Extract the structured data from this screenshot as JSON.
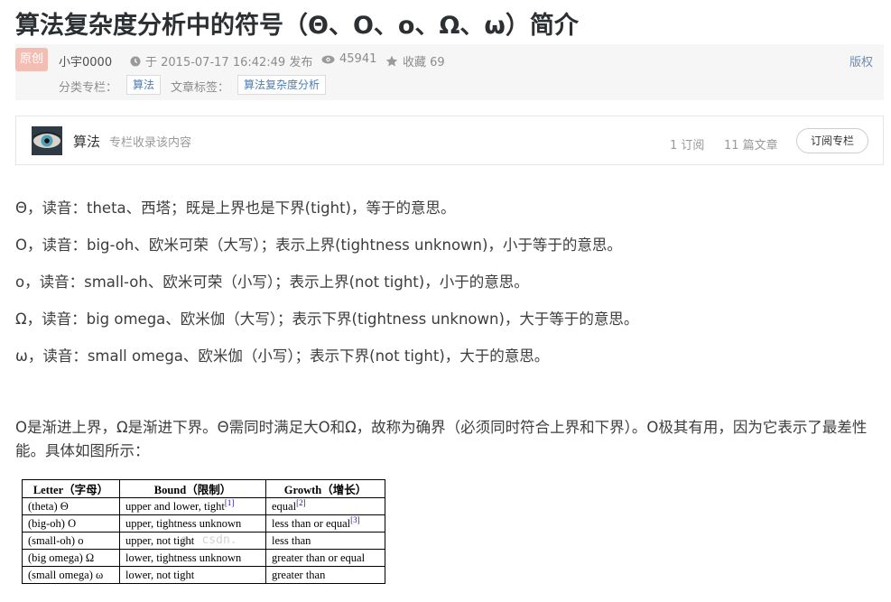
{
  "article": {
    "title": "算法复杂度分析中的符号（Θ、Ο、ο、Ω、ω）简介"
  },
  "meta": {
    "badge": "原创",
    "author": "小宇0000",
    "date": "于 2015-07-17 16:42:49 发布",
    "views": "45941",
    "favorites": "收藏 69",
    "copyright": "版权",
    "category_label": "分类专栏：",
    "category_tag": "算法",
    "article_tag_label": "文章标签：",
    "article_tag": "算法复杂度分析"
  },
  "column": {
    "name": "算法",
    "desc": "专栏收录该内容",
    "subscribers": "1 订阅",
    "articles": "11 篇文章",
    "subscribe_btn": "订阅专栏"
  },
  "content": {
    "p1": "Θ，读音：theta、西塔；既是上界也是下界(tight)，等于的意思。",
    "p2": "Ο，读音：big-oh、欧米可荣（大写）；表示上界(tightness unknown)，小于等于的意思。",
    "p3": "ο，读音：small-oh、欧米可荣（小写）；表示上界(not tight)，小于的意思。",
    "p4": "Ω，读音：big omega、欧米伽（大写）；表示下界(tightness unknown)，大于等于的意思。",
    "p5": "ω，读音：small omega、欧米伽（小写）；表示下界(not tight)，大于的意思。",
    "p6": "Ο是渐进上界，Ω是渐进下界。Θ需同时满足大Ο和Ω，故称为确界（必须同时符合上界和下界）。Ο极其有用，因为它表示了最差性能。具体如图所示："
  },
  "table": {
    "headers": [
      "Letter（字母）",
      "Bound（限制）",
      "Growth（增长）"
    ],
    "rows": [
      {
        "letter": "(theta) Θ",
        "bound": "upper and lower, tight",
        "bound_ref": "[1]",
        "growth": "equal",
        "growth_ref": "[2]"
      },
      {
        "letter": "(big-oh) O",
        "bound": "upper, tightness unknown",
        "bound_ref": "",
        "growth": "less than or equal",
        "growth_ref": "[3]"
      },
      {
        "letter": "(small-oh) o",
        "bound": "upper, not tight",
        "bound_ref": "",
        "growth": "less than",
        "growth_ref": ""
      },
      {
        "letter": "(big omega) Ω",
        "bound": "lower, tightness unknown",
        "bound_ref": "",
        "growth": "greater than or equal",
        "growth_ref": ""
      },
      {
        "letter": "(small omega) ω",
        "bound": "lower, not tight",
        "bound_ref": "",
        "growth": "greater than",
        "growth_ref": ""
      }
    ],
    "watermark": "g. csdn."
  },
  "colors": {
    "badge": "#f4bdb4",
    "link": "#4f7cae",
    "meta_bg": "#f6f6f6"
  }
}
